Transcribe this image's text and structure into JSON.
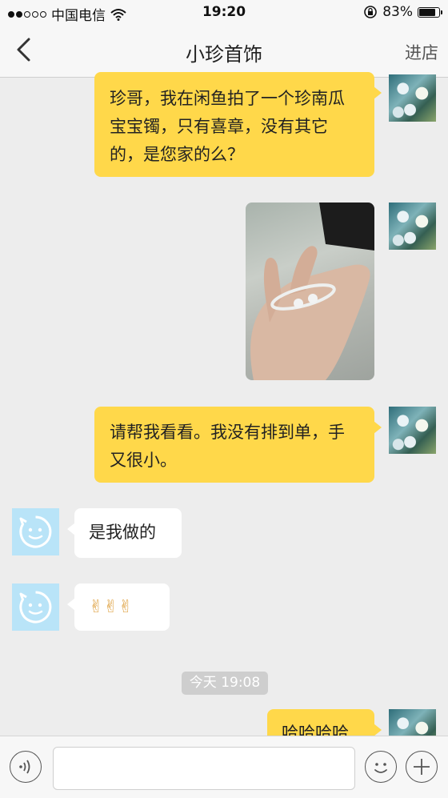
{
  "status_bar": {
    "carrier": "中国电信",
    "time": "19:20",
    "battery": "83%",
    "battery_level": 0.83,
    "signal_filled": 2,
    "signal_total": 5
  },
  "nav": {
    "title": "小珍首饰",
    "right_label": "进店"
  },
  "messages": [
    {
      "side": "right",
      "type": "text",
      "text": "珍哥，我在闲鱼拍了一个珍南瓜宝宝镯，只有喜章，没有其它的，是您家的么？"
    },
    {
      "side": "right",
      "type": "image",
      "alt": "hand holding silver bangle"
    },
    {
      "side": "right",
      "type": "text",
      "text": "请帮我看看。我没有排到单，手又很小。"
    },
    {
      "side": "left",
      "type": "text",
      "text": "是我做的"
    },
    {
      "side": "left",
      "type": "text",
      "text": "✌✌✌"
    },
    {
      "side": "center",
      "type": "timestamp",
      "text": "今天 19:08"
    },
    {
      "side": "right",
      "type": "text",
      "text": "哈哈哈哈"
    }
  ],
  "input": {
    "placeholder": ""
  },
  "colors": {
    "own_bubble": "#ffd84a",
    "other_bubble": "#ffffff",
    "background": "#ededed",
    "other_avatar": "#b9e4f8"
  },
  "icons": {
    "voice": "voice-icon",
    "emoji": "emoji-icon",
    "plus": "plus-icon",
    "back": "back-chevron-icon"
  }
}
